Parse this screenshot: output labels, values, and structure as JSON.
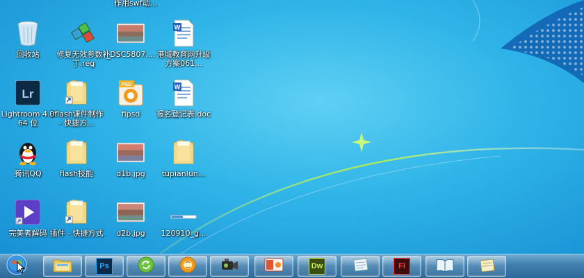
{
  "desktop": {
    "top_partial_label": "作用swf动...",
    "icons": [
      {
        "label": "回收站",
        "icon": "recycle-bin-icon"
      },
      {
        "label": "修复无效参数补丁.reg",
        "icon": "registry-file-icon"
      },
      {
        "label": "_DSC5807....",
        "icon": "photo-thumbnail-icon"
      },
      {
        "label": "港城教育网升级方案061...",
        "icon": "word-document-icon"
      },
      {
        "label": "Lightroom 4.3 64 位",
        "icon": "lightroom-icon"
      },
      {
        "label": "0flash课件制作 - 快捷方...",
        "icon": "folder-shortcut-icon"
      },
      {
        "label": "fipsd",
        "icon": "psd-file-icon"
      },
      {
        "label": "报名登记表.doc",
        "icon": "word-document-icon"
      },
      {
        "label": "腾讯QQ",
        "icon": "qq-penguin-icon"
      },
      {
        "label": "flash技能",
        "icon": "folder-icon"
      },
      {
        "label": "d1b.jpg",
        "icon": "photo-thumbnail-icon"
      },
      {
        "label": "tupianlun...",
        "icon": "folder-icon"
      },
      {
        "label": "完美者解码",
        "icon": "media-player-icon"
      },
      {
        "label": "插件 - 快捷方式",
        "icon": "folder-shortcut-icon"
      },
      {
        "label": "d2b.jpg",
        "icon": "photo-thumbnail-icon"
      },
      {
        "label": "120910_g...",
        "icon": "file-renaming-icon"
      }
    ]
  },
  "taskbar": {
    "start_icon": "windows-orb-icon",
    "apps": [
      {
        "name": "explorer",
        "icon": "folder-explorer-icon"
      },
      {
        "name": "photoshop",
        "icon": "photoshop-icon",
        "text": "Ps"
      },
      {
        "name": "refresh",
        "icon": "refresh-icon"
      },
      {
        "name": "media",
        "icon": "media-icon"
      },
      {
        "name": "camera",
        "icon": "camera-icon"
      },
      {
        "name": "presentation",
        "icon": "presentation-icon"
      },
      {
        "name": "dreamweaver",
        "icon": "dreamweaver-icon",
        "text": "Dw"
      },
      {
        "name": "notes",
        "icon": "notes-icon"
      },
      {
        "name": "flash",
        "icon": "flash-icon",
        "text": "Fl"
      },
      {
        "name": "book",
        "icon": "book-icon"
      },
      {
        "name": "document",
        "icon": "document-icon"
      }
    ]
  },
  "colors": {
    "photoshop": "#0b2a4a",
    "photoshop_text": "#31a8ff",
    "dreamweaver": "#3a4d12",
    "dreamweaver_text": "#c8f260",
    "flash": "#3b0d0d",
    "flash_text": "#ff3a3a"
  }
}
